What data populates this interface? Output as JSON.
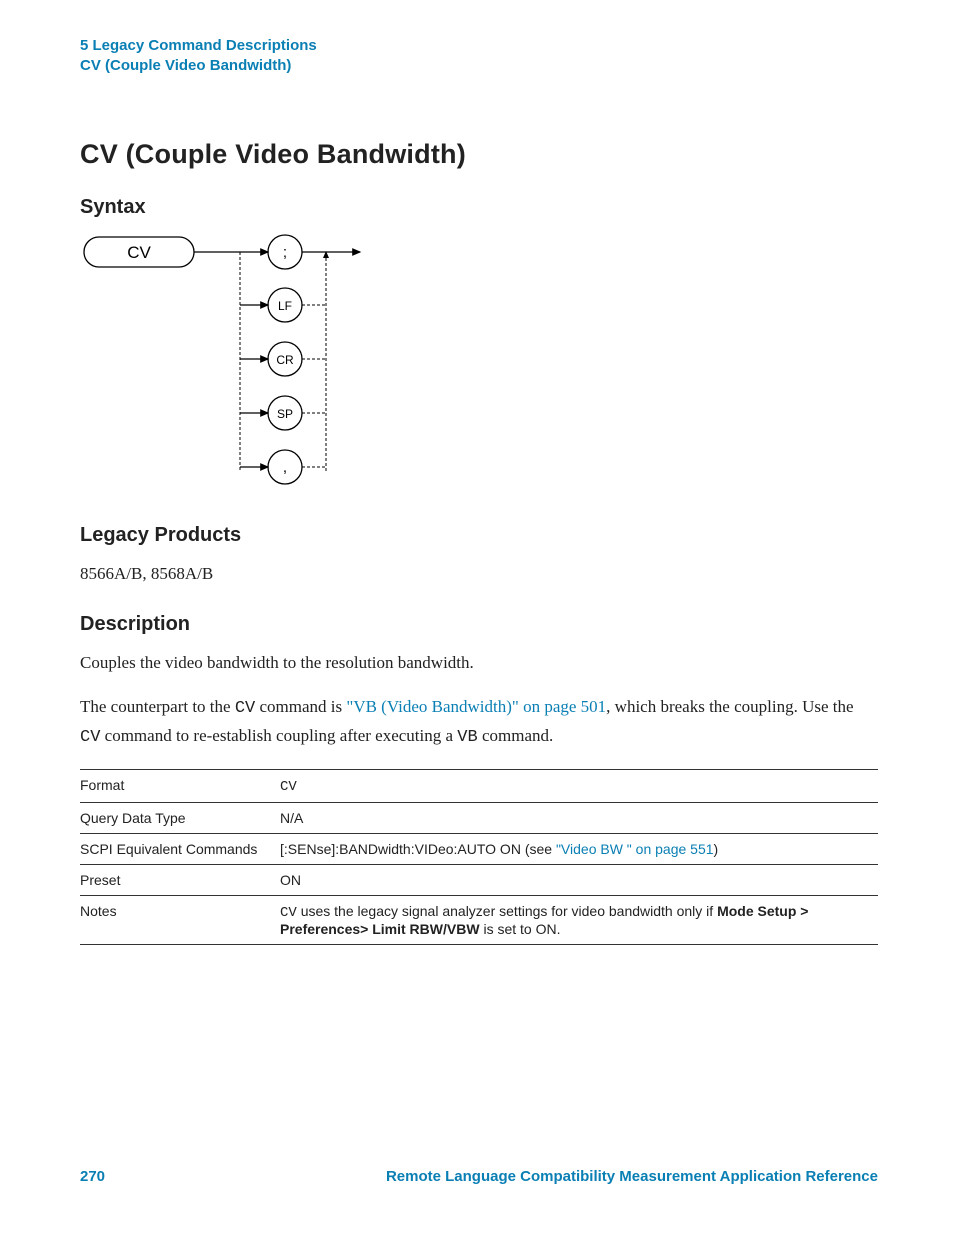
{
  "header": {
    "line1": "5  Legacy Command Descriptions",
    "line2": "CV (Couple Video Bandwidth)"
  },
  "title": "CV (Couple Video Bandwidth)",
  "sections": {
    "syntax": "Syntax",
    "legacy": "Legacy Products",
    "desc": "Description"
  },
  "diagram": {
    "start": "CV",
    "opts": [
      ";",
      "LF",
      "CR",
      "SP",
      ","
    ]
  },
  "legacy_products": "8566A/B, 8568A/B",
  "description": {
    "p1": "Couples the video bandwidth to the resolution bandwidth.",
    "p2a": "The counterpart to the ",
    "p2code1": "CV",
    "p2b": " command is ",
    "p2link": "\"VB (Video Bandwidth)\" on page 501",
    "p2c": ", which breaks the coupling. Use the ",
    "p2code2": "CV",
    "p2d": " command to re-establish coupling after executing a ",
    "p2code3": "VB",
    "p2e": " command."
  },
  "table": {
    "r1k": "Format",
    "r1v": "CV",
    "r2k": "Query Data Type",
    "r2v": "N/A",
    "r3k": "SCPI Equivalent Commands",
    "r3va": "[:SENse]:BANDwidth:VIDeo:AUTO ON (see ",
    "r3vlink": "\"Video BW \" on page 551",
    "r3vb": ")",
    "r4k": "Preset",
    "r4v": "ON",
    "r5k": "Notes",
    "r5code": "CV",
    "r5a": " uses the legacy signal analyzer settings for video bandwidth only if ",
    "r5bold": "Mode Setup > Preferences> Limit RBW/VBW",
    "r5b": " is set to ON."
  },
  "footer": {
    "page": "270",
    "ref": "Remote Language Compatibility Measurement Application Reference"
  }
}
